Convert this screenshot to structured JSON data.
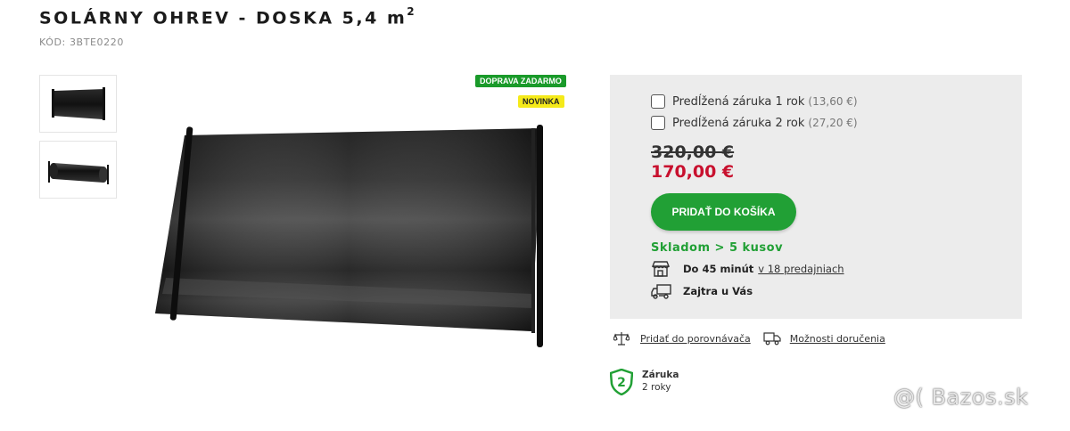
{
  "product": {
    "title": "SOLÁRNY OHREV - DOSKA 5,4 m",
    "title_sup": "2",
    "code_label": "KÓD: 3BTE0220"
  },
  "gallery": {
    "thumbnails": [
      "solar-panel-flat",
      "solar-panel-rolled"
    ]
  },
  "badges": {
    "free_shipping": "DOPRAVA ZADARMO",
    "new": "NOVINKA"
  },
  "options": [
    {
      "label": "Predĺžená záruka 1 rok",
      "price": "(13,60 €)",
      "checked": false
    },
    {
      "label": "Predĺžená záruka 2 rok",
      "price": "(27,20 €)",
      "checked": false
    }
  ],
  "pricing": {
    "old_price": "320,00 €",
    "new_price": "170,00 €"
  },
  "cart_button": "PRIDAŤ DO KOŠÍKA",
  "stock": {
    "status": "Skladom > 5 kusov",
    "pickup_bold": "Do 45 minút",
    "pickup_link": "v 18 predajniach",
    "delivery": "Zajtra u Vás"
  },
  "actions": {
    "compare": "Pridať do porovnávača",
    "delivery_options": "Možnosti doručenia"
  },
  "warranty": {
    "icon_number": "2",
    "title": "Záruka",
    "value": "2 roky"
  },
  "watermark": "@( Bazos.sk",
  "colors": {
    "accent_green": "#21a035",
    "sale_red": "#c8102e",
    "badge_yellow": "#f5ea1a",
    "panel_bg": "#ececec"
  }
}
